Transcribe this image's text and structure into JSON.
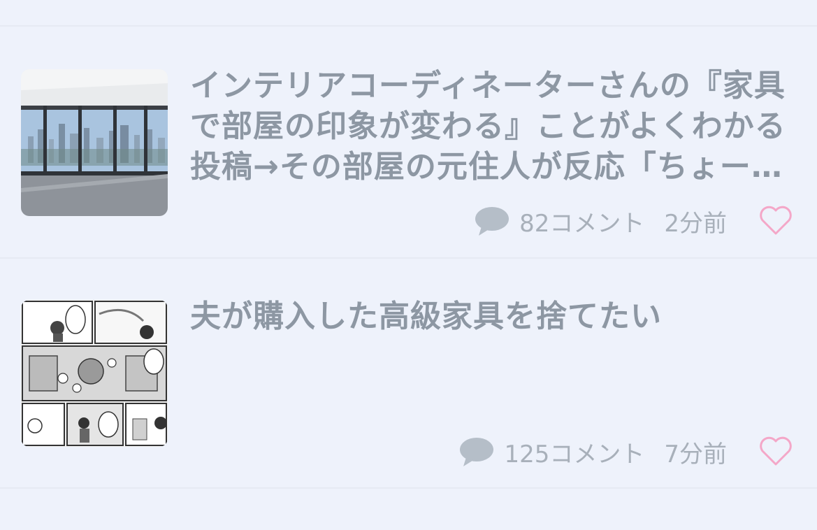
{
  "articles": [
    {
      "title": "インテリアコーディネーターさんの『家具で部屋の印象が変わる』ことがよくわかる投稿→その部屋の元住人が反応「ちょー…",
      "comments": "82コメント",
      "time": "2分前"
    },
    {
      "title": "夫が購入した高級家具を捨てたい",
      "comments": "125コメント",
      "time": "7分前"
    }
  ],
  "colors": {
    "background": "#eef2fb",
    "title": "#8d97a3",
    "meta": "#a8b0ba",
    "heart": "#f4a7c8"
  },
  "icons": {
    "comment": "speech-bubble-icon",
    "like": "heart-outline-icon"
  }
}
